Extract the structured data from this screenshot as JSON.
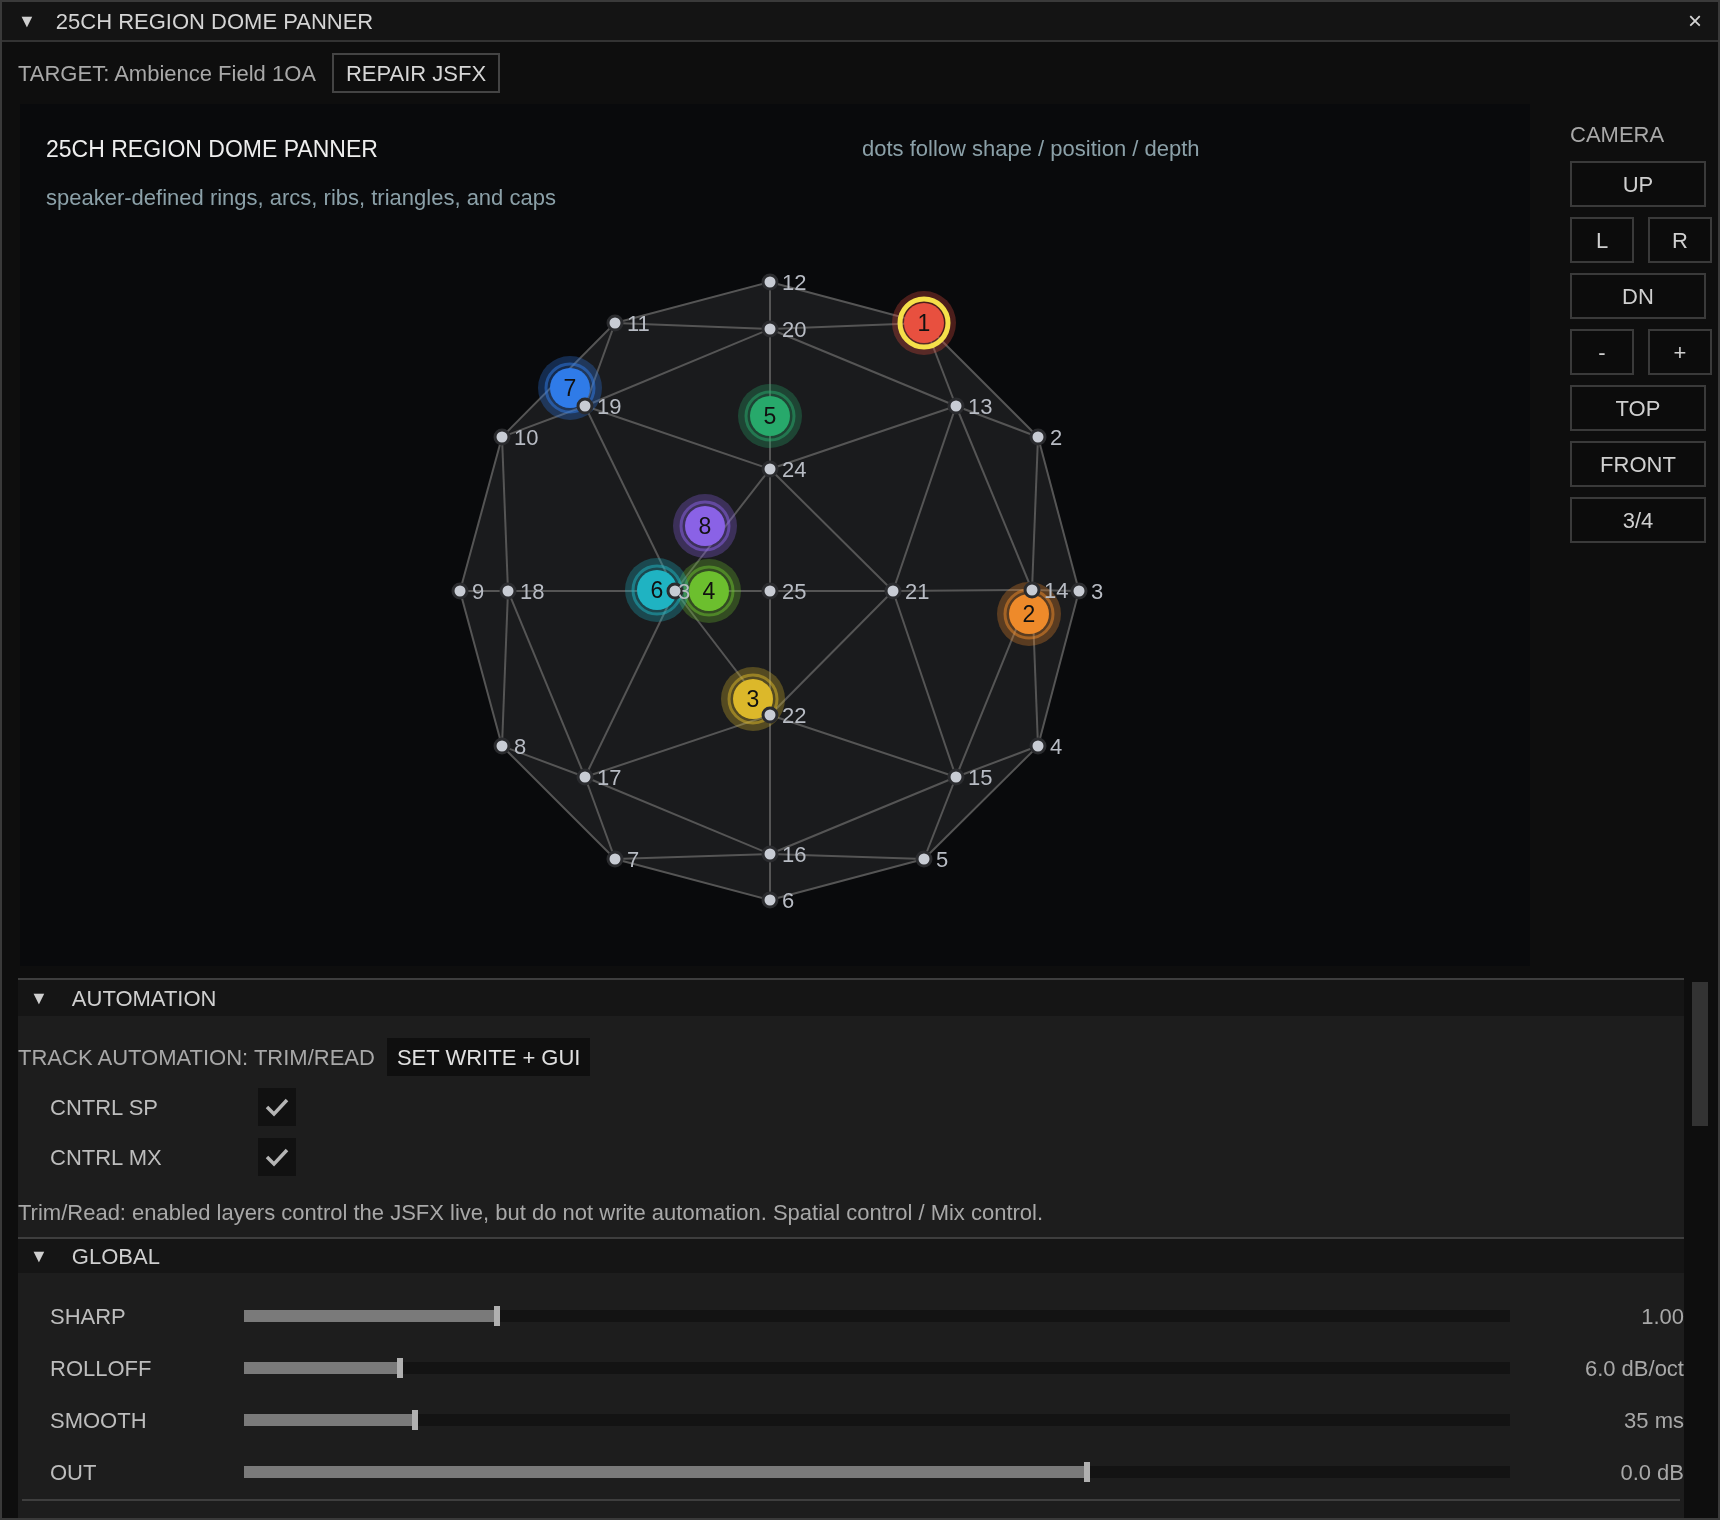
{
  "window": {
    "title": "25CH REGION DOME PANNER",
    "collapse_glyph": "▼",
    "close_glyph": "×"
  },
  "target": {
    "label": "TARGET: Ambience Field 1OA",
    "button": "REPAIR JSFX"
  },
  "dome": {
    "title": "25CH REGION DOME PANNER",
    "subtitle": "speaker-defined rings, arcs, ribs, triangles, and caps",
    "caption": "dots follow shape / position / depth",
    "speakers": [
      {
        "label": "12"
      },
      {
        "label": "11"
      },
      {
        "label": "20"
      },
      {
        "label": "19"
      },
      {
        "label": "13"
      },
      {
        "label": "10"
      },
      {
        "label": "2"
      },
      {
        "label": "24"
      },
      {
        "label": "9"
      },
      {
        "label": "18"
      },
      {
        "label": "3"
      },
      {
        "label": "25"
      },
      {
        "label": "21"
      },
      {
        "label": "14"
      },
      {
        "label": "3"
      },
      {
        "label": "22"
      },
      {
        "label": "8"
      },
      {
        "label": "4"
      },
      {
        "label": "17"
      },
      {
        "label": "15"
      },
      {
        "label": "7"
      },
      {
        "label": "16"
      },
      {
        "label": "5"
      },
      {
        "label": "6"
      }
    ],
    "sources": [
      {
        "label": "1",
        "color": "#e8503f",
        "selected": true
      },
      {
        "label": "2",
        "color": "#ee8a2a",
        "selected": false
      },
      {
        "label": "3",
        "color": "#dcb82a",
        "selected": false
      },
      {
        "label": "4",
        "color": "#6cbf2e",
        "selected": false
      },
      {
        "label": "5",
        "color": "#27a96b",
        "selected": false
      },
      {
        "label": "6",
        "color": "#1fb3c2",
        "selected": false
      },
      {
        "label": "7",
        "color": "#2f7be8",
        "selected": false
      },
      {
        "label": "8",
        "color": "#8a62e6",
        "selected": false
      }
    ]
  },
  "camera": {
    "title": "CAMERA",
    "buttons": [
      "UP",
      "L",
      "R",
      "DN",
      "-",
      "+",
      "TOP",
      "FRONT",
      "3/4"
    ]
  },
  "automation": {
    "title": "AUTOMATION",
    "glyph": "▼",
    "mode_label": "TRACK AUTOMATION: TRIM/READ",
    "mode_button": "SET WRITE + GUI",
    "options": [
      {
        "label": "CNTRL SP",
        "checked": true
      },
      {
        "label": "CNTRL MX",
        "checked": true
      }
    ],
    "note": "Trim/Read: enabled layers control the JSFX live, but do not write automation. Spatial control / Mix control."
  },
  "global": {
    "title": "GLOBAL",
    "glyph": "▼",
    "sliders": [
      {
        "label": "SHARP",
        "level": 0.2,
        "reading": "1.00"
      },
      {
        "label": "ROLLOFF",
        "level": 0.123,
        "reading": "6.0 dB/oct"
      },
      {
        "label": "SMOOTH",
        "level": 0.135,
        "reading": "35 ms"
      },
      {
        "label": "OUT",
        "level": 0.666,
        "reading": "0.0 dB"
      }
    ]
  }
}
